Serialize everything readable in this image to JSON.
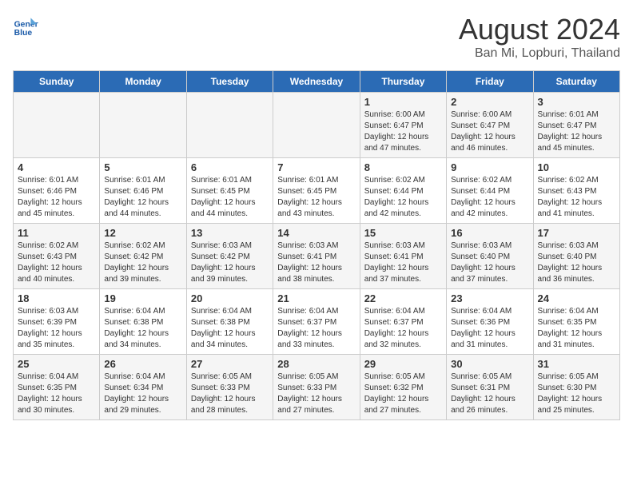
{
  "header": {
    "logo_line1": "General",
    "logo_line2": "Blue",
    "title": "August 2024",
    "subtitle": "Ban Mi, Lopburi, Thailand"
  },
  "days_of_week": [
    "Sunday",
    "Monday",
    "Tuesday",
    "Wednesday",
    "Thursday",
    "Friday",
    "Saturday"
  ],
  "weeks": [
    [
      {
        "day": "",
        "info": ""
      },
      {
        "day": "",
        "info": ""
      },
      {
        "day": "",
        "info": ""
      },
      {
        "day": "",
        "info": ""
      },
      {
        "day": "1",
        "info": "Sunrise: 6:00 AM\nSunset: 6:47 PM\nDaylight: 12 hours\nand 47 minutes."
      },
      {
        "day": "2",
        "info": "Sunrise: 6:00 AM\nSunset: 6:47 PM\nDaylight: 12 hours\nand 46 minutes."
      },
      {
        "day": "3",
        "info": "Sunrise: 6:01 AM\nSunset: 6:47 PM\nDaylight: 12 hours\nand 45 minutes."
      }
    ],
    [
      {
        "day": "4",
        "info": "Sunrise: 6:01 AM\nSunset: 6:46 PM\nDaylight: 12 hours\nand 45 minutes."
      },
      {
        "day": "5",
        "info": "Sunrise: 6:01 AM\nSunset: 6:46 PM\nDaylight: 12 hours\nand 44 minutes."
      },
      {
        "day": "6",
        "info": "Sunrise: 6:01 AM\nSunset: 6:45 PM\nDaylight: 12 hours\nand 44 minutes."
      },
      {
        "day": "7",
        "info": "Sunrise: 6:01 AM\nSunset: 6:45 PM\nDaylight: 12 hours\nand 43 minutes."
      },
      {
        "day": "8",
        "info": "Sunrise: 6:02 AM\nSunset: 6:44 PM\nDaylight: 12 hours\nand 42 minutes."
      },
      {
        "day": "9",
        "info": "Sunrise: 6:02 AM\nSunset: 6:44 PM\nDaylight: 12 hours\nand 42 minutes."
      },
      {
        "day": "10",
        "info": "Sunrise: 6:02 AM\nSunset: 6:43 PM\nDaylight: 12 hours\nand 41 minutes."
      }
    ],
    [
      {
        "day": "11",
        "info": "Sunrise: 6:02 AM\nSunset: 6:43 PM\nDaylight: 12 hours\nand 40 minutes."
      },
      {
        "day": "12",
        "info": "Sunrise: 6:02 AM\nSunset: 6:42 PM\nDaylight: 12 hours\nand 39 minutes."
      },
      {
        "day": "13",
        "info": "Sunrise: 6:03 AM\nSunset: 6:42 PM\nDaylight: 12 hours\nand 39 minutes."
      },
      {
        "day": "14",
        "info": "Sunrise: 6:03 AM\nSunset: 6:41 PM\nDaylight: 12 hours\nand 38 minutes."
      },
      {
        "day": "15",
        "info": "Sunrise: 6:03 AM\nSunset: 6:41 PM\nDaylight: 12 hours\nand 37 minutes."
      },
      {
        "day": "16",
        "info": "Sunrise: 6:03 AM\nSunset: 6:40 PM\nDaylight: 12 hours\nand 37 minutes."
      },
      {
        "day": "17",
        "info": "Sunrise: 6:03 AM\nSunset: 6:40 PM\nDaylight: 12 hours\nand 36 minutes."
      }
    ],
    [
      {
        "day": "18",
        "info": "Sunrise: 6:03 AM\nSunset: 6:39 PM\nDaylight: 12 hours\nand 35 minutes."
      },
      {
        "day": "19",
        "info": "Sunrise: 6:04 AM\nSunset: 6:38 PM\nDaylight: 12 hours\nand 34 minutes."
      },
      {
        "day": "20",
        "info": "Sunrise: 6:04 AM\nSunset: 6:38 PM\nDaylight: 12 hours\nand 34 minutes."
      },
      {
        "day": "21",
        "info": "Sunrise: 6:04 AM\nSunset: 6:37 PM\nDaylight: 12 hours\nand 33 minutes."
      },
      {
        "day": "22",
        "info": "Sunrise: 6:04 AM\nSunset: 6:37 PM\nDaylight: 12 hours\nand 32 minutes."
      },
      {
        "day": "23",
        "info": "Sunrise: 6:04 AM\nSunset: 6:36 PM\nDaylight: 12 hours\nand 31 minutes."
      },
      {
        "day": "24",
        "info": "Sunrise: 6:04 AM\nSunset: 6:35 PM\nDaylight: 12 hours\nand 31 minutes."
      }
    ],
    [
      {
        "day": "25",
        "info": "Sunrise: 6:04 AM\nSunset: 6:35 PM\nDaylight: 12 hours\nand 30 minutes."
      },
      {
        "day": "26",
        "info": "Sunrise: 6:04 AM\nSunset: 6:34 PM\nDaylight: 12 hours\nand 29 minutes."
      },
      {
        "day": "27",
        "info": "Sunrise: 6:05 AM\nSunset: 6:33 PM\nDaylight: 12 hours\nand 28 minutes."
      },
      {
        "day": "28",
        "info": "Sunrise: 6:05 AM\nSunset: 6:33 PM\nDaylight: 12 hours\nand 27 minutes."
      },
      {
        "day": "29",
        "info": "Sunrise: 6:05 AM\nSunset: 6:32 PM\nDaylight: 12 hours\nand 27 minutes."
      },
      {
        "day": "30",
        "info": "Sunrise: 6:05 AM\nSunset: 6:31 PM\nDaylight: 12 hours\nand 26 minutes."
      },
      {
        "day": "31",
        "info": "Sunrise: 6:05 AM\nSunset: 6:30 PM\nDaylight: 12 hours\nand 25 minutes."
      }
    ]
  ]
}
